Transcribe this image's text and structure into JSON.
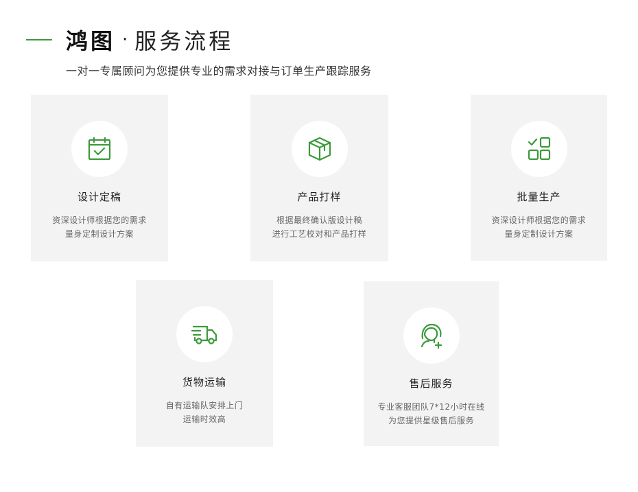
{
  "header": {
    "brand": "鸿图",
    "dot": "·",
    "title": "服务流程",
    "subtitle": "一对一专属顾问为您提供专业的需求对接与订单生产跟踪服务"
  },
  "colors": {
    "accent": "#3a9a3a",
    "card_bg": "#f3f3f3"
  },
  "cards": [
    {
      "icon": "calendar-check-icon",
      "title": "设计定稿",
      "desc": [
        "资深设计师根据您的需求",
        "量身定制设计方案"
      ]
    },
    {
      "icon": "box-icon",
      "title": "产品打样",
      "desc": [
        "根据最终确认版设计稿",
        "进行工艺校对和产品打样"
      ]
    },
    {
      "icon": "grid-check-icon",
      "title": "批量生产",
      "desc": [
        "资深设计师根据您的需求",
        "量身定制设计方案"
      ]
    },
    {
      "icon": "truck-icon",
      "title": "货物运输",
      "desc": [
        "自有运输队安排上门",
        "运输时效高"
      ]
    },
    {
      "icon": "customer-service-icon",
      "title": "售后服务",
      "desc": [
        "专业客服团队7*12小时在线",
        "为您提供星级售后服务"
      ]
    }
  ]
}
